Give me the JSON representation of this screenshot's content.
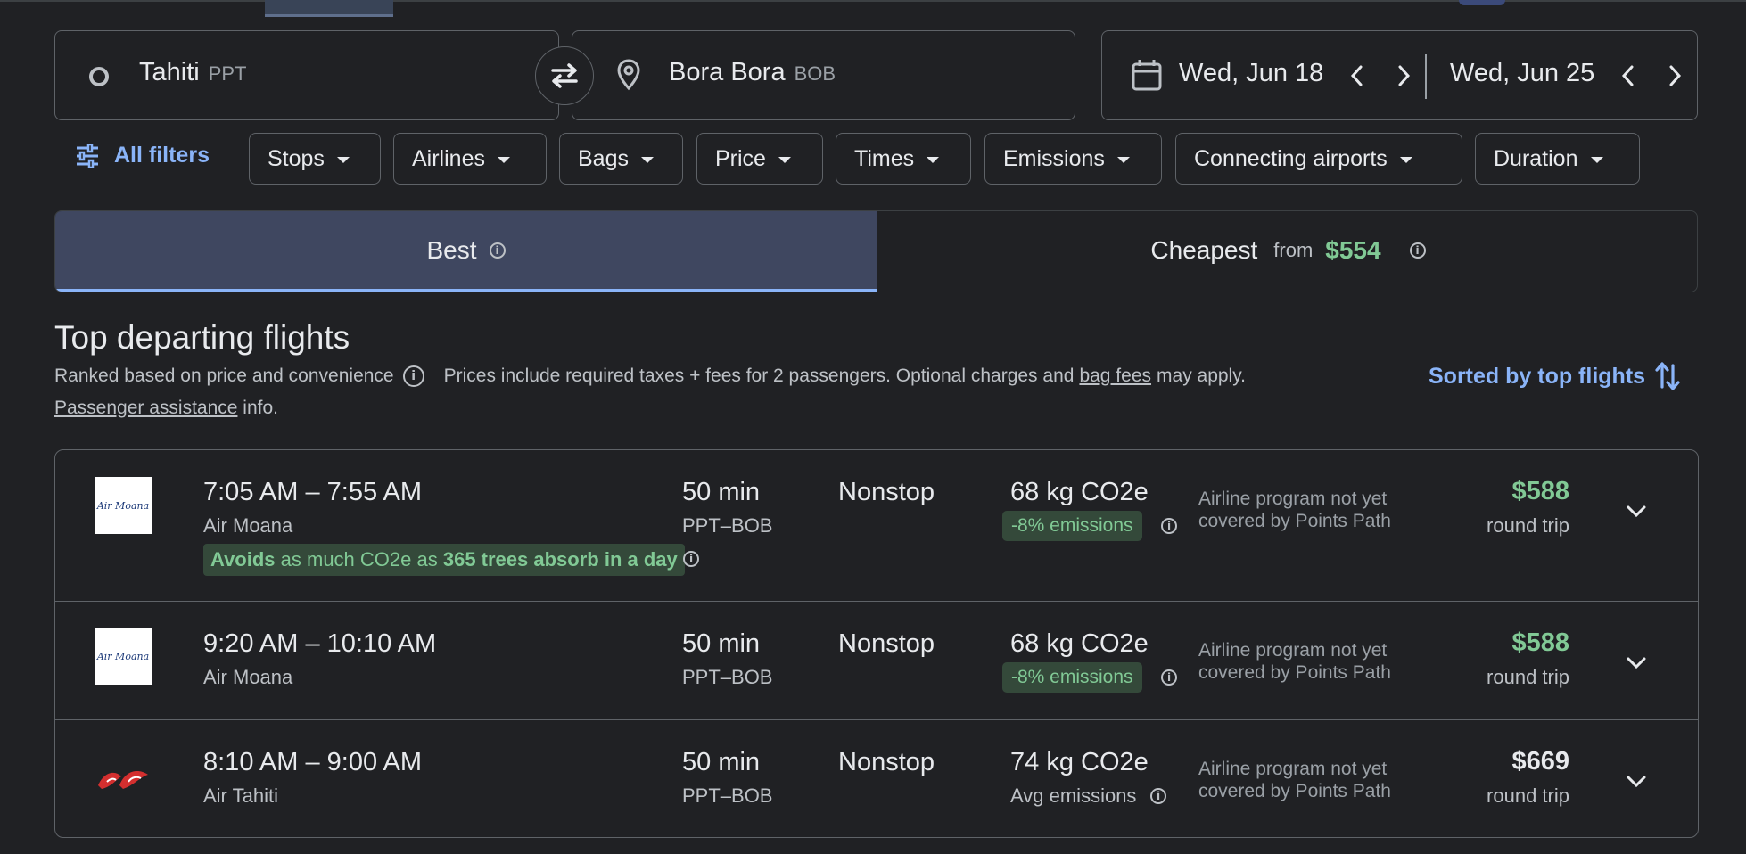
{
  "search": {
    "origin_city": "Tahiti",
    "origin_code": "PPT",
    "destination_city": "Bora Bora",
    "destination_code": "BOB",
    "depart_date": "Wed, Jun 18",
    "return_date": "Wed, Jun 25"
  },
  "filters": {
    "all_filters": "All filters",
    "chips": [
      "Stops",
      "Airlines",
      "Bags",
      "Price",
      "Times",
      "Emissions",
      "Connecting airports",
      "Duration"
    ]
  },
  "tabs": {
    "best": "Best",
    "cheapest": "Cheapest",
    "cheapest_from": "from",
    "cheapest_price": "$554"
  },
  "section": {
    "title": "Top departing flights",
    "ranked": "Ranked based on price and convenience",
    "prices_note": "Prices include required taxes + fees for 2 passengers. Optional charges and",
    "bag_fees": "bag fees",
    "may_apply": "may apply.",
    "passenger_assistance": "Passenger assistance",
    "info": "info.",
    "sorted": "Sorted by top flights"
  },
  "flights": [
    {
      "times": "7:05 AM – 7:55 AM",
      "airline": "Air Moana",
      "logo_text": "Air Moana",
      "duration": "50 min",
      "route": "PPT–BOB",
      "stops": "Nonstop",
      "co2": "68 kg CO2e",
      "emissions": "-8% emissions",
      "points": "Airline program not yet covered by Points Path",
      "price": "$588",
      "trip": "round trip",
      "avoid_a": "Avoids",
      "avoid_b": " as much CO2e as ",
      "avoid_c": "365 trees absorb in a day"
    },
    {
      "times": "9:20 AM – 10:10 AM",
      "airline": "Air Moana",
      "logo_text": "Air Moana",
      "duration": "50 min",
      "route": "PPT–BOB",
      "stops": "Nonstop",
      "co2": "68 kg CO2e",
      "emissions": "-8% emissions",
      "points": "Airline program not yet covered by Points Path",
      "price": "$588",
      "trip": "round trip"
    },
    {
      "times": "8:10 AM – 9:00 AM",
      "airline": "Air Tahiti",
      "duration": "50 min",
      "route": "PPT–BOB",
      "stops": "Nonstop",
      "co2": "74 kg CO2e",
      "emissions": "Avg emissions",
      "points": "Airline program not yet covered by Points Path",
      "price": "$669",
      "trip": "round trip"
    }
  ],
  "colors": {
    "background": "#202124",
    "accent": "#8ab4f8",
    "green_price": "#81c995",
    "emission_badge_bg": "#34493a"
  }
}
